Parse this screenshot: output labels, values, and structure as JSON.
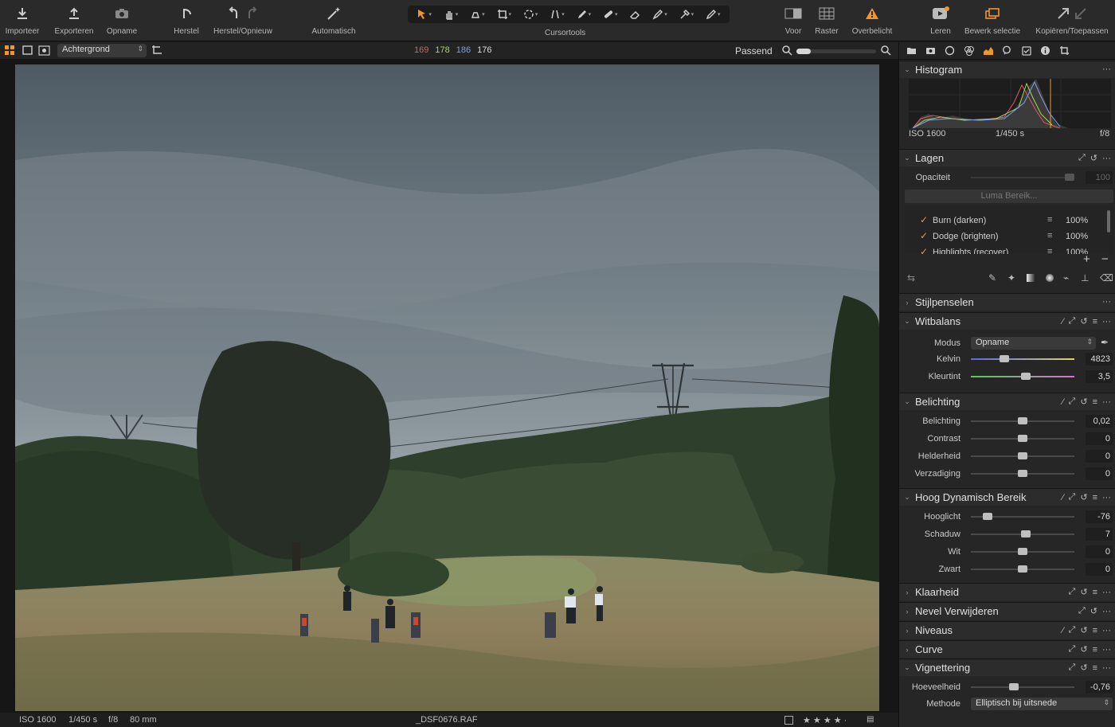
{
  "toolbar": {
    "import": "Importeer",
    "export": "Exporteren",
    "capture": "Opname",
    "reset": "Herstel",
    "undo_redo": "Herstel/Opnieuw",
    "auto": "Automatisch",
    "cursor_tools": "Cursortools",
    "before": "Voor",
    "grid": "Raster",
    "exposure_warning": "Overbelicht",
    "learn": "Leren",
    "edit_selection": "Bewerk selectie",
    "copy_apply": "Kopiëren/Toepassen"
  },
  "subbar": {
    "layer": "Achtergrond",
    "rgb_r": "169",
    "rgb_g": "178",
    "rgb_b": "186",
    "rgb_l": "176",
    "zoom": "Passend",
    "zoom_level": 0.15
  },
  "status": {
    "iso": "ISO 1600",
    "shutter": "1/450 s",
    "aperture": "f/8",
    "focal": "80 mm",
    "filename": "_DSF0676.RAF",
    "rating": "★ ★ ★ ★ ·"
  },
  "panel": {
    "histogram": {
      "title": "Histogram",
      "iso": "ISO 1600",
      "shutter": "1/450 s",
      "aperture": "f/8"
    },
    "layers": {
      "title": "Lagen",
      "opacity_label": "Opaciteit",
      "opacity_value": "100",
      "luma_button": "Luma Bereik...",
      "items": [
        {
          "name": "Burn (darken)",
          "percent": "100%"
        },
        {
          "name": "Dodge (brighten)",
          "percent": "100%"
        },
        {
          "name": "Highlights (recover)",
          "percent": "100%"
        }
      ]
    },
    "style_brushes": {
      "title": "Stijlpenselen"
    },
    "white_balance": {
      "title": "Witbalans",
      "mode_label": "Modus",
      "mode_value": "Opname",
      "kelvin_label": "Kelvin",
      "kelvin_value": "4823",
      "tint_label": "Kleurtint",
      "tint_value": "3,5"
    },
    "exposure": {
      "title": "Belichting",
      "rows": [
        {
          "label": "Belichting",
          "value": "0,02"
        },
        {
          "label": "Contrast",
          "value": "0"
        },
        {
          "label": "Helderheid",
          "value": "0"
        },
        {
          "label": "Verzadiging",
          "value": "0"
        }
      ]
    },
    "hdr": {
      "title": "Hoog Dynamisch Bereik",
      "rows": [
        {
          "label": "Hooglicht",
          "value": "-76"
        },
        {
          "label": "Schaduw",
          "value": "7"
        },
        {
          "label": "Wit",
          "value": "0"
        },
        {
          "label": "Zwart",
          "value": "0"
        }
      ]
    },
    "clarity": {
      "title": "Klaarheid"
    },
    "dehaze": {
      "title": "Nevel Verwijderen"
    },
    "levels": {
      "title": "Niveaus"
    },
    "curve": {
      "title": "Curve"
    },
    "vignetting": {
      "title": "Vignettering",
      "amount_label": "Hoeveelheid",
      "amount_value": "-0,76",
      "method_label": "Methode",
      "method_value": "Elliptisch bij uitsnede"
    }
  },
  "colors": {
    "accent": "#f0962a",
    "rgb_r": "#e05a5a",
    "rgb_g": "#a8d65a",
    "rgb_b": "#7f9fe8"
  }
}
